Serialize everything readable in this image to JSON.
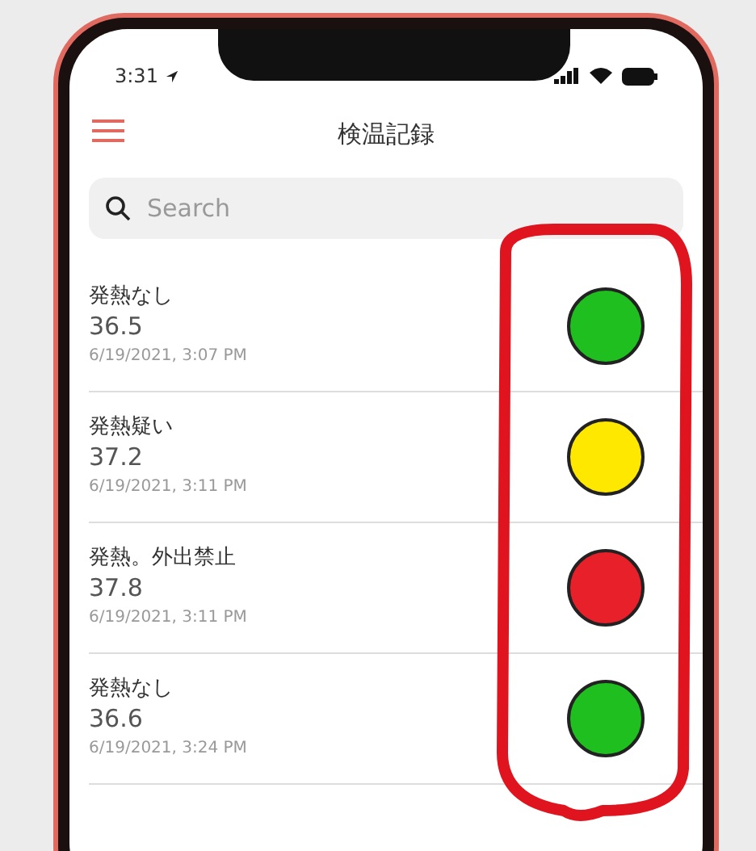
{
  "status_bar": {
    "time": "3:31"
  },
  "header": {
    "title": "検温記録"
  },
  "search": {
    "placeholder": "Search"
  },
  "records": [
    {
      "status": "発熱なし",
      "temperature": "36.5",
      "timestamp": "6/19/2021, 3:07 PM",
      "color": "#1fbf1f"
    },
    {
      "status": "発熱疑い",
      "temperature": "37.2",
      "timestamp": "6/19/2021, 3:11 PM",
      "color": "#ffe800"
    },
    {
      "status": "発熱。外出禁止",
      "temperature": "37.8",
      "timestamp": "6/19/2021, 3:11 PM",
      "color": "#e8202a"
    },
    {
      "status": "発熱なし",
      "temperature": "36.6",
      "timestamp": "6/19/2021, 3:24 PM",
      "color": "#1fbf1f"
    }
  ]
}
